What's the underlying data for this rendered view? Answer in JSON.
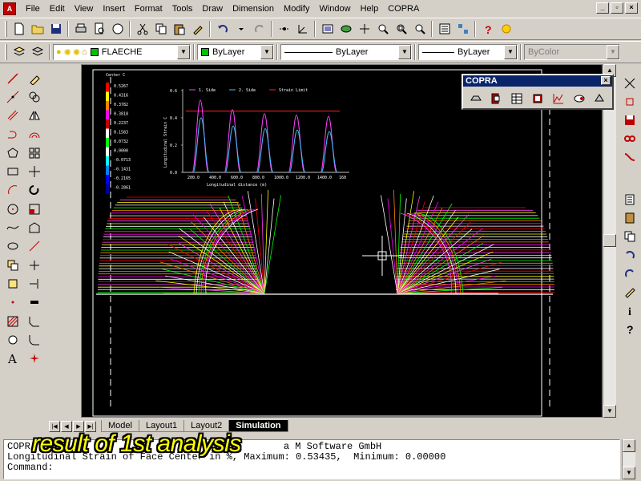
{
  "menubar": {
    "items": [
      "File",
      "Edit",
      "View",
      "Insert",
      "Format",
      "Tools",
      "Draw",
      "Dimension",
      "Modify",
      "Window",
      "Help",
      "COPRA"
    ]
  },
  "toolbar2": {
    "layer_name": "FLAECHE",
    "color": "ByLayer",
    "linetype": "ByLayer",
    "lineweight": "ByLayer",
    "plotstyle": "ByColor"
  },
  "copra_panel": {
    "title": "COPRA"
  },
  "layout_tabs": [
    "Model",
    "Layout1",
    "Layout2",
    "Simulation"
  ],
  "active_tab": "Simulation",
  "command": {
    "line1_left": "COPR",
    "line1_right": "a M Software GmbH",
    "line2": "Longitudinal Strain of Face Center in %, Maximum: 0.53435,  Minimum: 0.00000",
    "prompt": "Command:"
  },
  "caption": "result of 1st analysis",
  "color_scale": {
    "title": "Center C",
    "values": [
      "0.5267",
      "0.4316",
      "0.3782",
      "0.3818",
      "0.2237",
      "0.1583",
      "0.0732",
      "0.0000",
      "-0.0713",
      "-0.1431",
      "-0.2165",
      "-0.2861"
    ],
    "colors": [
      "#ff0000",
      "#ffff00",
      "#ff8000",
      "#ff00ff",
      "#c00000",
      "#ffffff",
      "#00ff00",
      "#ffffff",
      "#00ffff",
      "#0080ff",
      "#0000ff",
      "#0000a0"
    ]
  },
  "chart_data": {
    "type": "line",
    "ylabel": "Longitudinal Strain C",
    "xlabel": "Longitudinal distance (m)",
    "xticks": [
      "200.0",
      "400.0",
      "600.0",
      "800.0",
      "1000.0",
      "1200.0",
      "1400.0",
      "160"
    ],
    "yticks": [
      "0.6",
      "0.4",
      "0.2",
      "0.0"
    ],
    "ylim": [
      0,
      0.6
    ],
    "series": [
      {
        "name": "1. Side",
        "color": "#ff40ff",
        "peaks": [
          0.53,
          0.46,
          0.43,
          0.42,
          0.41
        ]
      },
      {
        "name": "2. Side",
        "color": "#40c0ff",
        "peaks": [
          0.4,
          0.34,
          0.32,
          0.31,
          0.3
        ]
      },
      {
        "name": "Strain Limit",
        "color": "#ff2020",
        "value": 0.45
      }
    ]
  }
}
